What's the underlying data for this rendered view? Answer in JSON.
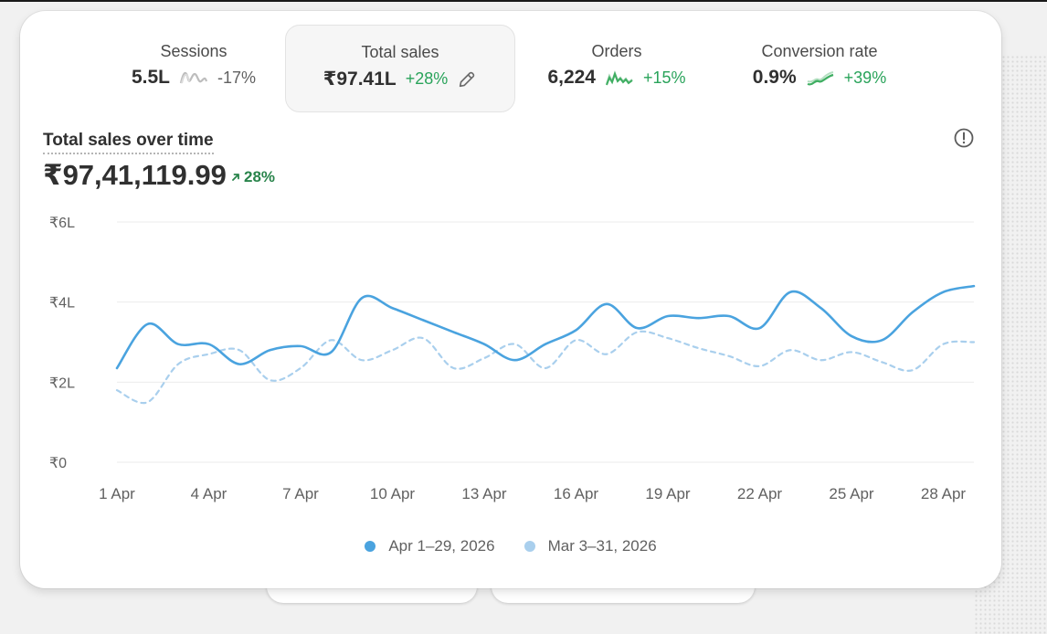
{
  "metrics": [
    {
      "label": "Sessions",
      "value": "5.5L",
      "change": "-17%",
      "positive": false
    },
    {
      "label": "Total sales",
      "value": "₹97.41L",
      "change": "+28%",
      "positive": true,
      "selected": true
    },
    {
      "label": "Orders",
      "value": "6,224",
      "change": "+15%",
      "positive": true
    },
    {
      "label": "Conversion rate",
      "value": "0.9%",
      "change": "+39%",
      "positive": true
    }
  ],
  "chart_header": {
    "title": "Total sales over time",
    "value": "₹97,41,119.99",
    "change": "28%"
  },
  "legend": [
    {
      "label": "Apr 1–29, 2026",
      "color": "#4aa3df"
    },
    {
      "label": "Mar 3–31, 2026",
      "color": "#a9cfed"
    }
  ],
  "icons": {
    "edit": "pencil-icon",
    "info": "alert-circle-icon",
    "change": "arrow-up-right-icon"
  },
  "colors": {
    "current": "#4aa3df",
    "previous": "#a9cfed",
    "positive": "#29a35a"
  },
  "chart_data": {
    "type": "line",
    "title": "Total sales over time",
    "ylim": [
      0,
      6
    ],
    "yticks": [
      "₹0",
      "₹2L",
      "₹4L",
      "₹6L"
    ],
    "ytick_values": [
      0,
      2,
      4,
      6
    ],
    "x": [
      1,
      2,
      3,
      4,
      5,
      6,
      7,
      8,
      9,
      10,
      11,
      12,
      13,
      14,
      15,
      16,
      17,
      18,
      19,
      20,
      21,
      22,
      23,
      24,
      25,
      26,
      27,
      28,
      29
    ],
    "xtick_labels": [
      "1 Apr",
      "4 Apr",
      "7 Apr",
      "10 Apr",
      "13 Apr",
      "16 Apr",
      "19 Apr",
      "22 Apr",
      "25 Apr",
      "28 Apr"
    ],
    "xtick_values": [
      1,
      4,
      7,
      10,
      13,
      16,
      19,
      22,
      25,
      28
    ],
    "grid": true,
    "legend_position": "bottom",
    "series": [
      {
        "name": "Apr 1–29, 2026",
        "style": "solid",
        "values": [
          2.35,
          3.45,
          2.95,
          2.95,
          2.45,
          2.8,
          2.9,
          2.75,
          4.1,
          3.85,
          3.55,
          3.25,
          2.95,
          2.55,
          2.95,
          3.3,
          3.95,
          3.35,
          3.65,
          3.6,
          3.65,
          3.35,
          4.25,
          3.85,
          3.15,
          3.05,
          3.75,
          4.25,
          4.4
        ]
      },
      {
        "name": "Mar 3–31, 2026",
        "style": "dashed",
        "values": [
          1.8,
          1.5,
          2.45,
          2.7,
          2.8,
          2.05,
          2.35,
          3.05,
          2.55,
          2.8,
          3.1,
          2.35,
          2.6,
          2.95,
          2.35,
          3.05,
          2.7,
          3.25,
          3.1,
          2.85,
          2.65,
          2.4,
          2.8,
          2.55,
          2.75,
          2.5,
          2.3,
          2.95,
          3.0
        ]
      }
    ]
  }
}
